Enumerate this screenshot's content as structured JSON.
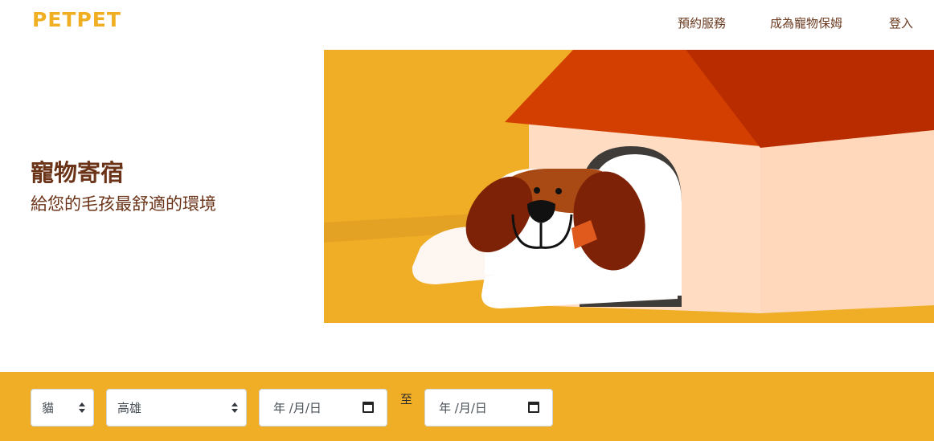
{
  "navbar": {
    "logo": "PETPET",
    "links": [
      "預約服務",
      "成為寵物保姆",
      "登入"
    ]
  },
  "hero": {
    "title": "寵物寄宿",
    "subtitle": "給您的毛孩最舒適的環境"
  },
  "search": {
    "pet_type": "貓",
    "city": "高雄",
    "date_start_placeholder": "年 /月/日",
    "to_label": "至",
    "date_end_placeholder": "年 /月/日"
  },
  "icons": {
    "select_arrow": "chevron-up-down-icon",
    "date": "calendar-icon"
  },
  "colors": {
    "brand": "#f0ae22",
    "text_brown": "#6b3318",
    "search_bar": "#f0ae26",
    "roof": "#d33f00",
    "house_wall": "#ffdcc2"
  }
}
